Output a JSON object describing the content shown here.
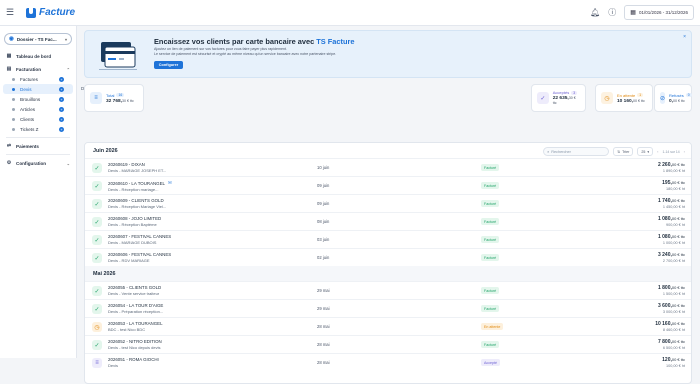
{
  "app": {
    "name": "Facture"
  },
  "topbar": {
    "date_range": "01/01/2026 - 31/12/2026"
  },
  "sidebar": {
    "dossier": "Dossier - TS Fac...",
    "dashboard": "Tableau de bord",
    "facturation": "Facturation",
    "items": [
      {
        "label": "Factures",
        "add": "+",
        "active": false
      },
      {
        "label": "Devis",
        "add": "+",
        "active": true
      },
      {
        "label": "Brouillons",
        "add": "+",
        "active": false
      },
      {
        "label": "Articles",
        "add": "+",
        "active": false
      },
      {
        "label": "Clients",
        "add": "+",
        "active": false
      },
      {
        "label": "Tickets Z",
        "add": "+",
        "active": false
      }
    ],
    "paiements": "Paiements",
    "configuration": "Configuration"
  },
  "banner": {
    "title": "Encaissez vos clients par carte bancaire avec ",
    "brand": "TS Facture",
    "line1": "Ajoutez un lien de paiement sur vos factures pour vous faire payer plus rapidement.",
    "line2": "Le service de paiement est sécurisé et crypté au même niveau qu'un service bancaire avec notre partenaire stripe.",
    "button": "Configurer",
    "close": "×"
  },
  "section": {
    "label": "Devis créés"
  },
  "stats": [
    {
      "label": "Total",
      "count": "16",
      "amount": "32 768,",
      "cents": "30 € ttc",
      "color": "#1e73d8",
      "bg": "#e6f0fc",
      "icon": "≡"
    },
    {
      "label": "Acceptés",
      "count": "3",
      "amount": "22 635,",
      "cents": "30 € ttc",
      "color": "#6b5fd3",
      "bg": "#eeecfb",
      "icon": "✓"
    },
    {
      "label": "En attente",
      "count": "1",
      "amount": "10 160,",
      "cents": "00 € ttc",
      "color": "#e08a12",
      "bg": "#fdf2e1",
      "icon": "◷"
    },
    {
      "label": "Refusés",
      "count": "0",
      "amount": "0,",
      "cents": "00 € ttc",
      "color": "#1e73d8",
      "bg": "#e6f0fc",
      "icon": "⊘"
    }
  ],
  "toolbar": {
    "search_placeholder": "Rechercher",
    "sort": "Trier",
    "page_size": "25",
    "pager": "1-14 sur 14"
  },
  "months": [
    {
      "label": "Juin 2026",
      "rows": [
        {
          "num": "20260619 - DIXAN",
          "desc": "Devis - MARIAGE JOSEPH ET...",
          "date": "10 juin",
          "status": "Facturé",
          "ttc": "2 260,",
          "ttc_c": "00 € ttc",
          "ht": "1 890,00 € ht",
          "mail": false
        },
        {
          "num": "20260610 - LA TOURANGEL",
          "desc": "Devis - Réception mariage...",
          "date": "09 juin",
          "status": "Facturé",
          "ttc": "195,",
          "ttc_c": "00 € ttc",
          "ht": "180,00 € ht",
          "mail": true
        },
        {
          "num": "20260609 - CLIENTS GOLD",
          "desc": "Devis - Réception Mariage Viel...",
          "date": "09 juin",
          "status": "Facturé",
          "ttc": "1 740,",
          "ttc_c": "00 € ttc",
          "ht": "1 450,00 € ht",
          "mail": false
        },
        {
          "num": "20260608 - JOJO LIMITED",
          "desc": "Devis - Réception Baptème",
          "date": "08 juin",
          "status": "Facturé",
          "ttc": "1 080,",
          "ttc_c": "00 € ttc",
          "ht": "900,00 € ht",
          "mail": false
        },
        {
          "num": "20260607 - FESTIVAL CANNES",
          "desc": "Devis - MARIAGE DUBOIS",
          "date": "03 juin",
          "status": "Facturé",
          "ttc": "1 080,",
          "ttc_c": "00 € ttc",
          "ht": "1 000,00 € ht",
          "mail": false
        },
        {
          "num": "20260606 - FESTIVAL CANNES",
          "desc": "Devis - RDV MARIAGE",
          "date": "02 juin",
          "status": "Facturé",
          "ttc": "3 240,",
          "ttc_c": "00 € ttc",
          "ht": "2 700,00 € ht",
          "mail": false
        }
      ]
    },
    {
      "label": "Mai 2026",
      "rows": [
        {
          "num": "2026055 - CLIENTS GOLD",
          "desc": "Devis - Vente service traiteur",
          "date": "29 mai",
          "status": "Facturé",
          "ttc": "1 800,",
          "ttc_c": "00 € ttc",
          "ht": "1 500,00 € ht",
          "mail": false
        },
        {
          "num": "2026054 - LA TOUR D'AIGE",
          "desc": "Devis - Préparation réception...",
          "date": "29 mai",
          "status": "Facturé",
          "ttc": "3 600,",
          "ttc_c": "00 € ttc",
          "ht": "3 000,00 € ht",
          "mail": false
        },
        {
          "num": "2026053 - LA TOURANGEL",
          "desc": "BDC - test Nico BDC",
          "date": "28 mai",
          "status": "En attente",
          "ttc": "10 160,",
          "ttc_c": "00 € ttc",
          "ht": "8 460,00 € ht",
          "mail": false
        },
        {
          "num": "2026052 - NITRO EDITION",
          "desc": "Devis - test Nico depuis devis",
          "date": "28 mai",
          "status": "Facturé",
          "ttc": "7 800,",
          "ttc_c": "00 € ttc",
          "ht": "6 500,00 € ht",
          "mail": false
        },
        {
          "num": "2026051 - ROMA GIOCHI",
          "desc": "Devis",
          "date": "28 mai",
          "status": "Accepté",
          "ttc": "120,",
          "ttc_c": "00 € ttc",
          "ht": "100,00 € ht",
          "mail": false
        }
      ]
    }
  ],
  "colors": {
    "accent": "#1e73d8",
    "invoiced": "#23a36a",
    "pending": "#e08a12",
    "accepted": "#6b5fd3"
  }
}
